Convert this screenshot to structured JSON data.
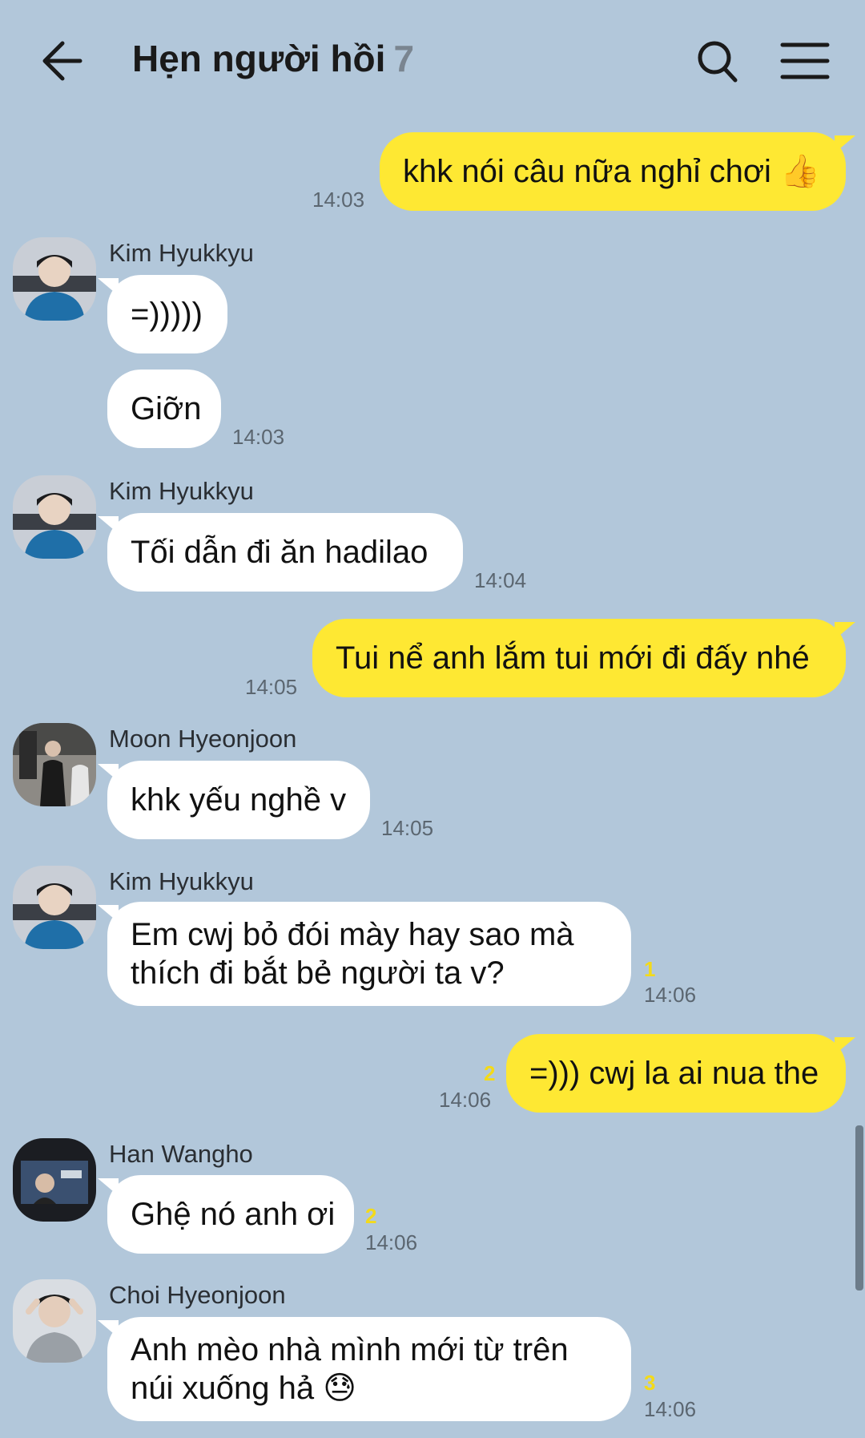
{
  "header": {
    "title": "Hẹn người hồi",
    "member_count": "7",
    "back_icon": "back-arrow-icon",
    "search_icon": "search-icon",
    "menu_icon": "hamburger-menu-icon"
  },
  "colors": {
    "background": "#b2c7da",
    "outgoing_bubble": "#fee833",
    "incoming_bubble": "#ffffff",
    "unread_count": "#f3da1a"
  },
  "messages": [
    {
      "direction": "out",
      "text": "khk nói câu nữa nghỉ chơi 👍",
      "time": "14:03"
    },
    {
      "direction": "in",
      "sender": "Kim Hyukkyu",
      "text": "=)))))"
    },
    {
      "direction": "in",
      "text": "Giỡn",
      "time": "14:03"
    },
    {
      "direction": "in",
      "sender": "Kim Hyukkyu",
      "text": "Tối dẫn đi ăn hadilao",
      "time": "14:04"
    },
    {
      "direction": "out",
      "text": "Tui nể anh lắm tui mới đi đấy nhé",
      "time": "14:05"
    },
    {
      "direction": "in",
      "sender": "Moon Hyeonjoon",
      "text": "khk yếu nghề v",
      "time": "14:05"
    },
    {
      "direction": "in",
      "sender": "Kim Hyukkyu",
      "text_line1": "Em cwj bỏ đói mày hay sao mà",
      "text_line2": "thích đi bắt bẻ người ta v?",
      "unread": "1",
      "time": "14:06"
    },
    {
      "direction": "out",
      "text": "=))) cwj la ai nua the",
      "unread": "2",
      "time": "14:06"
    },
    {
      "direction": "in",
      "sender": "Han Wangho",
      "text": "Ghệ nó anh ơi",
      "unread": "2",
      "time": "14:06"
    },
    {
      "direction": "in",
      "sender": "Choi Hyeonjoon",
      "text_line1": "Anh mèo nhà mình mới từ trên",
      "text_line2": "núi xuống hả 😓",
      "unread": "3",
      "time": "14:06"
    }
  ]
}
